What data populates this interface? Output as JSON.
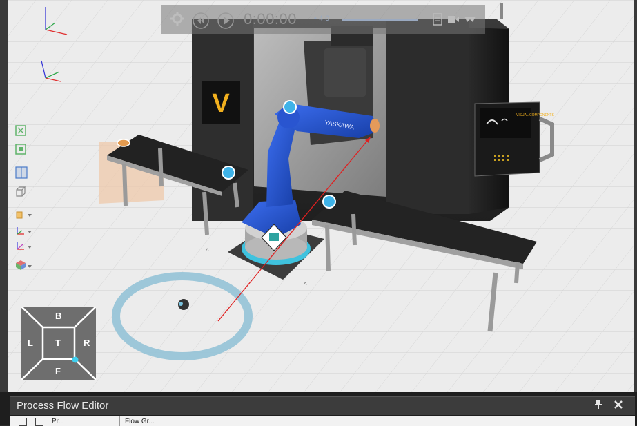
{
  "playback": {
    "time": "0:00:00",
    "speed": "• 4.0",
    "settings_icon": "gear-icon",
    "rewind_icon": "rewind-icon",
    "play_icon": "play-icon",
    "pdf_icon": "pdf-export-icon",
    "video_icon": "video-record-icon",
    "vr_icon": "vr-icon"
  },
  "scene": {
    "machine_logo": "V",
    "robot_brand": "YASKAWA",
    "panel_brand": "VISUAL COMPONENTS"
  },
  "side_toolbar": [
    {
      "name": "fill-view-icon"
    },
    {
      "name": "fit-selection-icon"
    },
    {
      "name": "split-view-icon"
    },
    {
      "name": "box-view-icon"
    },
    {
      "name": "render-mode-icon"
    },
    {
      "name": "coordinate-frame-icon"
    },
    {
      "name": "snap-frame-icon"
    },
    {
      "name": "color-cube-icon"
    }
  ],
  "navcube": {
    "back": "B",
    "left": "L",
    "top": "T",
    "right": "R",
    "front": "F"
  },
  "panel": {
    "title": "Process Flow Editor",
    "pin_icon": "pin-icon",
    "close_icon": "close-icon",
    "col_1": "Pr...",
    "col_2": "Flow Gr..."
  },
  "colors": {
    "floor": "#e9e9e9",
    "robot_blue": "#1f4fc2",
    "highlight_cyan": "#3fd0f0",
    "ring": "#8fc1d6",
    "panel_bg": "#3c3c3c"
  }
}
